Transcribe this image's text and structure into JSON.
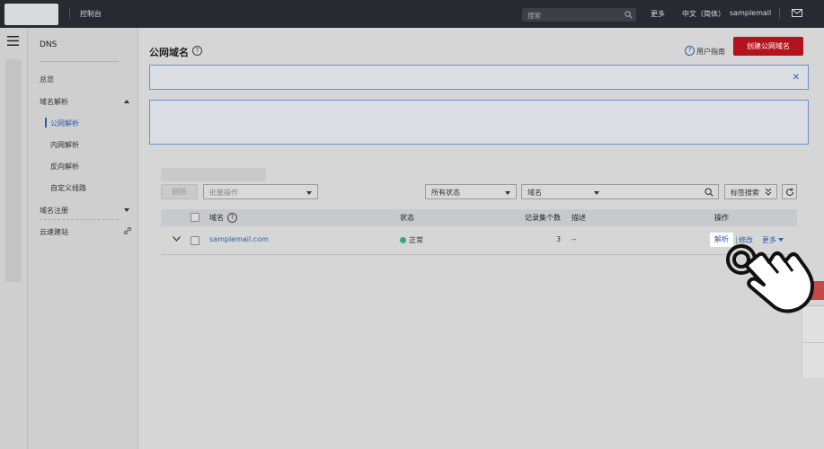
{
  "topbar": {
    "console": "控制台",
    "search_placeholder": "搜索",
    "more": "更多",
    "language": "中文（简体）",
    "user": "samplemail"
  },
  "sidebar": {
    "title": "DNS",
    "overview": "总览",
    "domain_resolution": "域名解析",
    "sub_items": [
      "公网解析",
      "内网解析",
      "反向解析",
      "自定义线路"
    ],
    "domain_registration": "域名注册",
    "site_building": "云速建站"
  },
  "page": {
    "title": "公网域名",
    "user_guide": "用户指南",
    "create_button": "创建公网域名"
  },
  "toolbar": {
    "delete": "删除",
    "batch_ops": "批量操作",
    "status_filter": "所有状态",
    "field_select": "域名",
    "tag_search": "标签搜索"
  },
  "table": {
    "headers": {
      "domain": "域名",
      "status": "状态",
      "record_sets": "记录集个数",
      "description": "描述",
      "actions": "操作"
    },
    "rows": [
      {
        "domain": "samplemail.com",
        "status": "正常",
        "record_sets": "3",
        "description": "--",
        "actions": {
          "parse": "解析",
          "edit": "修改",
          "more": "更多"
        }
      }
    ]
  },
  "colors": {
    "topbar": "#272a30",
    "primary_red": "#b3131b",
    "link_blue": "#2f5ea8",
    "status_green": "#3aa86b"
  }
}
